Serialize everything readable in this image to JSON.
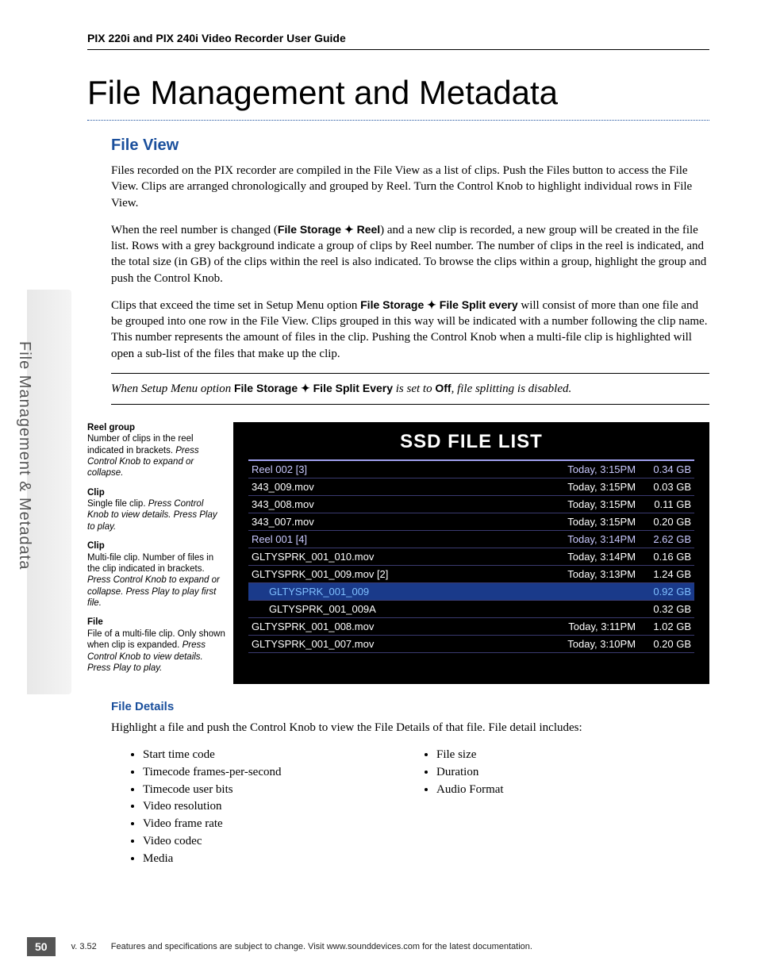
{
  "header": {
    "running": "PIX 220i and PIX 240i Video Recorder User Guide"
  },
  "sideTab": "File Management & Metadata",
  "title": "File Management and Metadata",
  "section1": {
    "heading": "File View",
    "p1": "Files recorded on the PIX recorder are compiled in the File View as a list of clips. Push the Files button to access the File View. Clips are arranged chronologically and grouped by Reel. Turn the Control Knob to highlight individual rows in File View.",
    "p2a": "When the reel number is changed (",
    "p2b": "File Storage ",
    "p2c": " Reel",
    "p2d": ") and a new clip is recorded, a new group will be created in the file list. Rows with a grey background indicate a group of clips by Reel number. The number of clips in the reel is indicated, and the total size (in GB) of the clips within the reel is also indicated. To browse the clips within a group, highlight the group and push the Control Knob.",
    "p3a": "Clips that exceed the time set in Setup Menu option ",
    "p3b": "File Storage ",
    "p3c": " File Split every",
    "p3d": " will consist of more than one file and be grouped into one row in the File View. Clips grouped in this way will be indicated with a number following the clip name. This number represents the amount of files in the clip. Pushing the Control Knob when a multi-file clip is highlighted will open a sub-list of the files that make up the clip."
  },
  "note": {
    "a": "When Setup Menu option ",
    "b": "File Storage ",
    "c": " File Split Every",
    "d": " is set to ",
    "e": "Off",
    "f": ", file splitting is disabled."
  },
  "callouts": [
    {
      "title": "Reel group",
      "text": "Number of clips in the reel indicated in brackets. ",
      "italic": "Press Control Knob to expand or collapse."
    },
    {
      "title": "Clip",
      "text": "Single file clip. ",
      "italic": "Press Control Knob to view details. Press Play to play."
    },
    {
      "title": "Clip",
      "text": "Multi-file clip. Number of files in the clip indicated in brackets. ",
      "italic": "Press Control Knob to expand or collapse. Press Play to play first file."
    },
    {
      "title": "File",
      "text": "File of a multi-file clip. Only shown when clip is expanded. ",
      "italic": "Press Control Knob to view details. Press Play to play."
    }
  ],
  "ssd": {
    "title": "SSD FILE LIST",
    "rows": [
      {
        "name": "Reel 002 [3]",
        "time": "Today, 3:15PM",
        "size": "0.34 GB",
        "cls": "reel"
      },
      {
        "name": "343_009.mov",
        "time": "Today, 3:15PM",
        "size": "0.03 GB",
        "cls": ""
      },
      {
        "name": "343_008.mov",
        "time": "Today, 3:15PM",
        "size": "0.11 GB",
        "cls": ""
      },
      {
        "name": "343_007.mov",
        "time": "Today, 3:15PM",
        "size": "0.20 GB",
        "cls": ""
      },
      {
        "name": "Reel 001 [4]",
        "time": "Today, 3:14PM",
        "size": "2.62 GB",
        "cls": "reel"
      },
      {
        "name": "GLTYSPRK_001_010.mov",
        "time": "Today, 3:14PM",
        "size": "0.16 GB",
        "cls": ""
      },
      {
        "name": "GLTYSPRK_001_009.mov [2]",
        "time": "Today, 3:13PM",
        "size": "1.24 GB",
        "cls": ""
      },
      {
        "name": "GLTYSPRK_001_009",
        "time": "",
        "size": "0.92 GB",
        "cls": "sel indent"
      },
      {
        "name": "GLTYSPRK_001_009A",
        "time": "",
        "size": "0.32 GB",
        "cls": "indent"
      },
      {
        "name": "GLTYSPRK_001_008.mov",
        "time": "Today, 3:11PM",
        "size": "1.02 GB",
        "cls": ""
      },
      {
        "name": "GLTYSPRK_001_007.mov",
        "time": "Today, 3:10PM",
        "size": "0.20 GB",
        "cls": ""
      }
    ]
  },
  "section2": {
    "heading": "File Details",
    "intro": "Highlight a file and push the Control Knob to view the File Details of that file. File detail includes:",
    "col1": [
      "Start time code",
      "Timecode frames-per-second",
      "Timecode user bits",
      "Video resolution",
      "Video frame rate",
      "Video codec",
      "Media"
    ],
    "col2": [
      "File size",
      "Duration",
      "Audio Format"
    ]
  },
  "footer": {
    "page": "50",
    "version": "v. 3.52",
    "text": "Features and specifications are subject to change. Visit www.sounddevices.com for the latest documentation."
  }
}
